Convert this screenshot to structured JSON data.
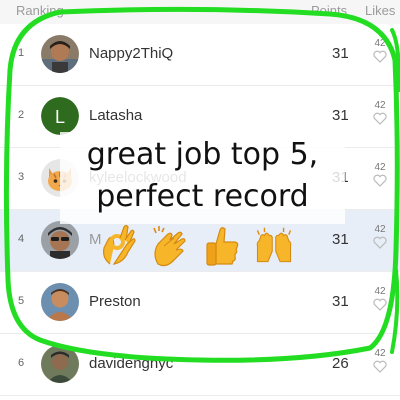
{
  "header": {
    "ranking_label": "Ranking",
    "points_label": "Points",
    "likes_label": "Likes"
  },
  "rows": [
    {
      "rank": "1",
      "username": "Nappy2ThiQ",
      "points": "31",
      "likes": "42",
      "avatar": "photo"
    },
    {
      "rank": "2",
      "username": "Latasha",
      "points": "31",
      "likes": "42",
      "avatar": "letter",
      "avatar_letter": "L",
      "avatar_color": "#2e6b1f"
    },
    {
      "rank": "3",
      "username": "kyleelockwood",
      "points": "31",
      "likes": "42",
      "avatar": "cat"
    },
    {
      "rank": "4",
      "username": "M",
      "points": "31",
      "likes": "42",
      "avatar": "photo",
      "highlighted": true
    },
    {
      "rank": "5",
      "username": "Preston",
      "points": "31",
      "likes": "42",
      "avatar": "photo"
    },
    {
      "rank": "6",
      "username": "davidenghyc",
      "points": "26",
      "likes": "42",
      "avatar": "photo"
    }
  ],
  "caption": {
    "line1": "great job top 5,",
    "line2": "perfect record"
  },
  "emojis": [
    "ok-hand-emoji",
    "clapping-hands-emoji",
    "thumbs-up-emoji",
    "raising-hands-emoji"
  ],
  "colors": {
    "highlight_row": "#e7eef8",
    "marker_stroke": "#22dd22",
    "emoji_yellow": "#f7b52a"
  }
}
